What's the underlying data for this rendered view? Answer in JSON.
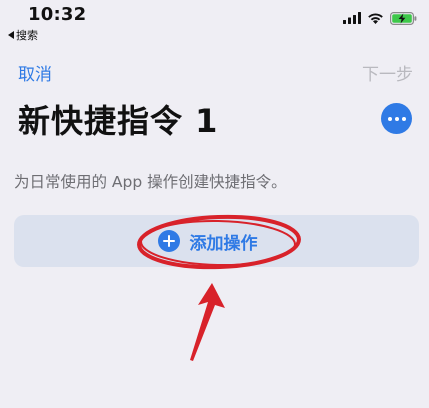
{
  "status_bar": {
    "time": "10:32",
    "back_app": "搜索",
    "icons": [
      "cellular-signal-icon",
      "wifi-icon",
      "battery-charging-icon"
    ]
  },
  "nav": {
    "cancel_label": "取消",
    "next_label": "下一步"
  },
  "header": {
    "title": "新快捷指令 1",
    "more_icon": "ellipsis-icon"
  },
  "description": "为日常使用的 App 操作创建快捷指令。",
  "add_action": {
    "label": "添加操作",
    "icon": "plus-circle-icon"
  },
  "colors": {
    "accent": "#2f7ae5",
    "background": "#efeef4",
    "action_bg": "#dbe1ee",
    "annotation": "#d8222a"
  }
}
